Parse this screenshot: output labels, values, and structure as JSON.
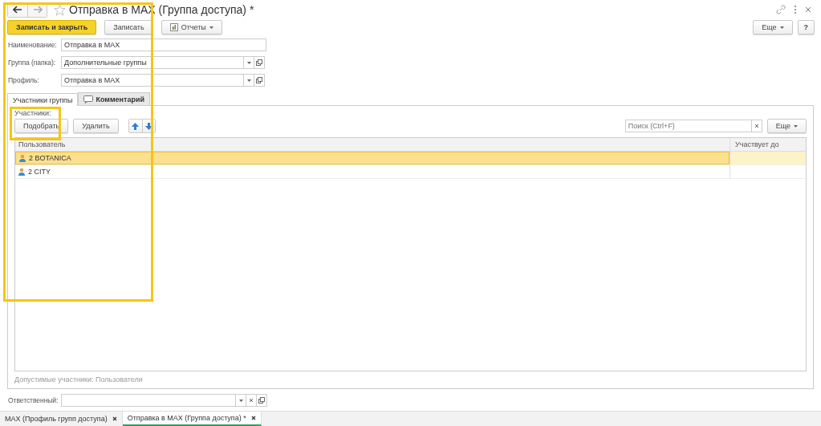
{
  "window": {
    "title": "Отправка в MAX (Группа доступа) *"
  },
  "toolbar": {
    "buttons": [
      {
        "label": "Записать и закрыть",
        "kind": "primary"
      },
      {
        "label": "Записать",
        "kind": "plain"
      },
      {
        "label": "Отчеты",
        "kind": "menu"
      }
    ],
    "more": "Еще",
    "help": "?"
  },
  "fields": [
    {
      "label": "Наименование:",
      "value": "Отправка в MAX",
      "kind": "text"
    },
    {
      "label": "Группа (папка):",
      "value": "Дополнительные группы",
      "kind": "select"
    },
    {
      "label": "Профиль:",
      "value": "Отправка в MAX",
      "kind": "select"
    }
  ],
  "tabs": [
    {
      "label": "Участники группы",
      "selected": true
    },
    {
      "label": "Комментарий",
      "selected": false
    }
  ],
  "members": {
    "label": "Участники:",
    "buttons": [
      "Подобрать",
      "Удалить"
    ],
    "search": {
      "placeholder": "Поиск (Ctrl+F)"
    },
    "more": "Еще",
    "columns": [
      "Пользователь",
      "Участвует до"
    ],
    "rows": [
      {
        "user": "2  BOTANICA",
        "selected": true
      },
      {
        "user": "2  CITY",
        "selected": false
      }
    ],
    "footer": "Допустимые участники: Пользователи"
  },
  "responsible": {
    "label": "Ответственный:"
  },
  "open_windows": [
    {
      "label": "MAX (Профиль групп доступа)",
      "selected": false
    },
    {
      "label": "Отправка в MAX (Группа доступа) *",
      "selected": true
    }
  ]
}
